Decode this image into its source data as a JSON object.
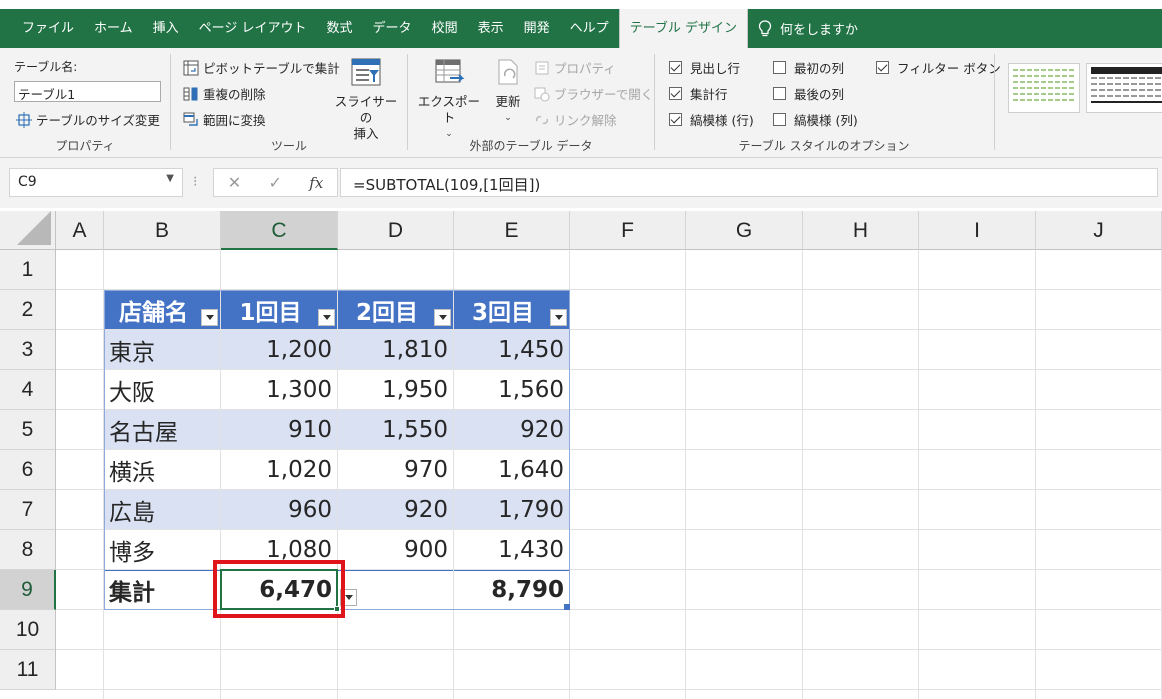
{
  "menu": {
    "tabs": [
      "ファイル",
      "ホーム",
      "挿入",
      "ページ レイアウト",
      "数式",
      "データ",
      "校閲",
      "表示",
      "開発",
      "ヘルプ"
    ],
    "active_tab": "テーブル デザイン",
    "tell_me": "何をしますか"
  },
  "ribbon": {
    "properties": {
      "table_name_label": "テーブル名:",
      "table_name_value": "テーブル1",
      "resize": "テーブルのサイズ変更",
      "group": "プロパティ"
    },
    "tools": {
      "pivot": "ピボットテーブルで集計",
      "remove_duplicates": "重複の削除",
      "convert_range": "範囲に変換",
      "slicer_line1": "スライサーの",
      "slicer_line2": "挿入",
      "group": "ツール"
    },
    "external": {
      "export": "エクスポート",
      "refresh": "更新",
      "properties": "プロパティ",
      "open_browser": "ブラウザーで開く",
      "unlink": "リンク解除",
      "group": "外部のテーブル データ"
    },
    "style_options": {
      "header_row": "見出し行",
      "total_row": "集計行",
      "banded_rows": "縞模様 (行)",
      "first_column": "最初の列",
      "last_column": "最後の列",
      "banded_columns": "縞模様 (列)",
      "filter_button": "フィルター ボタン",
      "checked": {
        "header_row": true,
        "total_row": true,
        "banded_rows": true,
        "first_column": false,
        "last_column": false,
        "banded_columns": false,
        "filter_button": true
      },
      "group": "テーブル スタイルのオプション"
    }
  },
  "formula_bar": {
    "name_box": "C9",
    "formula": "=SUBTOTAL(109,[1回目])"
  },
  "grid": {
    "columns": [
      "A",
      "B",
      "C",
      "D",
      "E",
      "F",
      "G",
      "H",
      "I",
      "J"
    ],
    "rows": [
      "1",
      "2",
      "3",
      "4",
      "5",
      "6",
      "7",
      "8",
      "9",
      "10",
      "11"
    ],
    "selected_column": "C",
    "selected_row": "9"
  },
  "table": {
    "headers": [
      "店舗名",
      "1回目",
      "2回目",
      "3回目"
    ],
    "rows": [
      [
        "東京",
        "1,200",
        "1,810",
        "1,450"
      ],
      [
        "大阪",
        "1,300",
        "1,950",
        "1,560"
      ],
      [
        "名古屋",
        "910",
        "1,550",
        "920"
      ],
      [
        "横浜",
        "1,020",
        "970",
        "1,640"
      ],
      [
        "広島",
        "960",
        "920",
        "1,790"
      ],
      [
        "博多",
        "1,080",
        "900",
        "1,430"
      ]
    ],
    "total": [
      "集計",
      "6,470",
      "",
      "8,790"
    ]
  },
  "colors": {
    "excel_green": "#217346",
    "table_header": "#4472c4",
    "band": "#d9e1f2",
    "highlight": "#e0141b"
  }
}
